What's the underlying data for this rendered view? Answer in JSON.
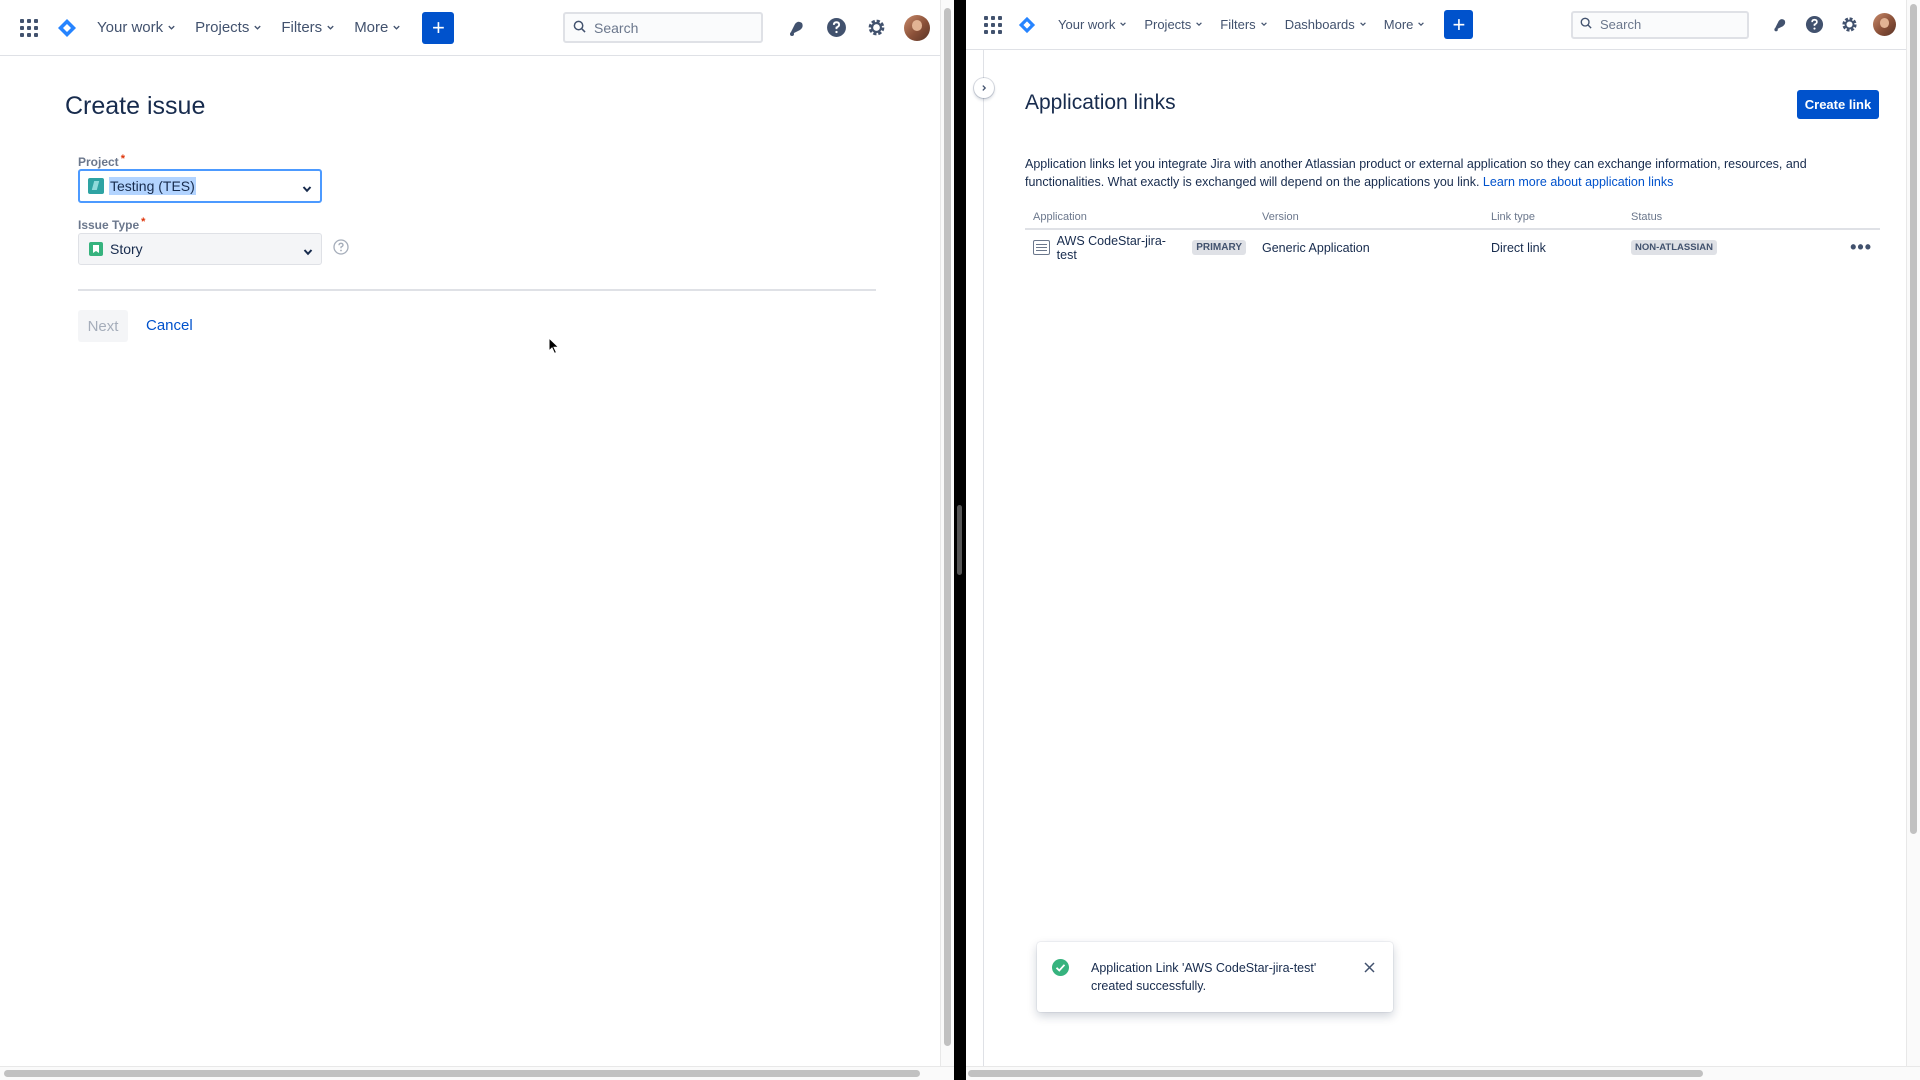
{
  "left": {
    "nav": {
      "items": [
        "Your work",
        "Projects",
        "Filters",
        "More"
      ],
      "create": "+",
      "search_placeholder": "Search"
    },
    "form": {
      "title": "Create issue",
      "project_label": "Project",
      "project_value": "Testing (TES)",
      "issue_type_label": "Issue Type",
      "issue_type_value": "Story",
      "required_mark": "*",
      "next_label": "Next",
      "cancel_label": "Cancel"
    }
  },
  "right": {
    "nav": {
      "items": [
        "Your work",
        "Projects",
        "Filters",
        "Dashboards",
        "More"
      ],
      "create": "+",
      "search_placeholder": "Search"
    },
    "page": {
      "title": "Application links",
      "create_link_label": "Create link",
      "description": "Application links let you integrate Jira with another Atlassian product or external application so they can exchange information, resources, and functionalities. What exactly is exchanged will depend on the applications you link.",
      "learn_more": "Learn more about application links"
    },
    "table": {
      "headers": [
        "Application",
        "Version",
        "Link type",
        "Status"
      ],
      "rows": [
        {
          "application": "AWS CodeStar-jira-test",
          "badge": "PRIMARY",
          "version": "Generic Application",
          "link_type": "Direct link",
          "status": "NON-ATLASSIAN",
          "actions": "•••"
        }
      ]
    },
    "flag": {
      "message": "Application Link 'AWS CodeStar-jira-test' created successfully."
    }
  },
  "colors": {
    "brand_blue": "#0052cc",
    "success_green": "#36b37e",
    "focus_ring": "#4c9aff",
    "text": "#172b4d",
    "subtle_text": "#6b778c"
  },
  "icons": [
    "app-grid-icon",
    "jira-logo-icon",
    "chevron-down-icon",
    "search-icon",
    "notification-icon",
    "help-icon",
    "settings-icon",
    "project-icon",
    "story-icon",
    "help-circle-icon",
    "application-icon",
    "chevron-right-icon",
    "check-circle-icon",
    "close-icon",
    "cursor-icon"
  ]
}
